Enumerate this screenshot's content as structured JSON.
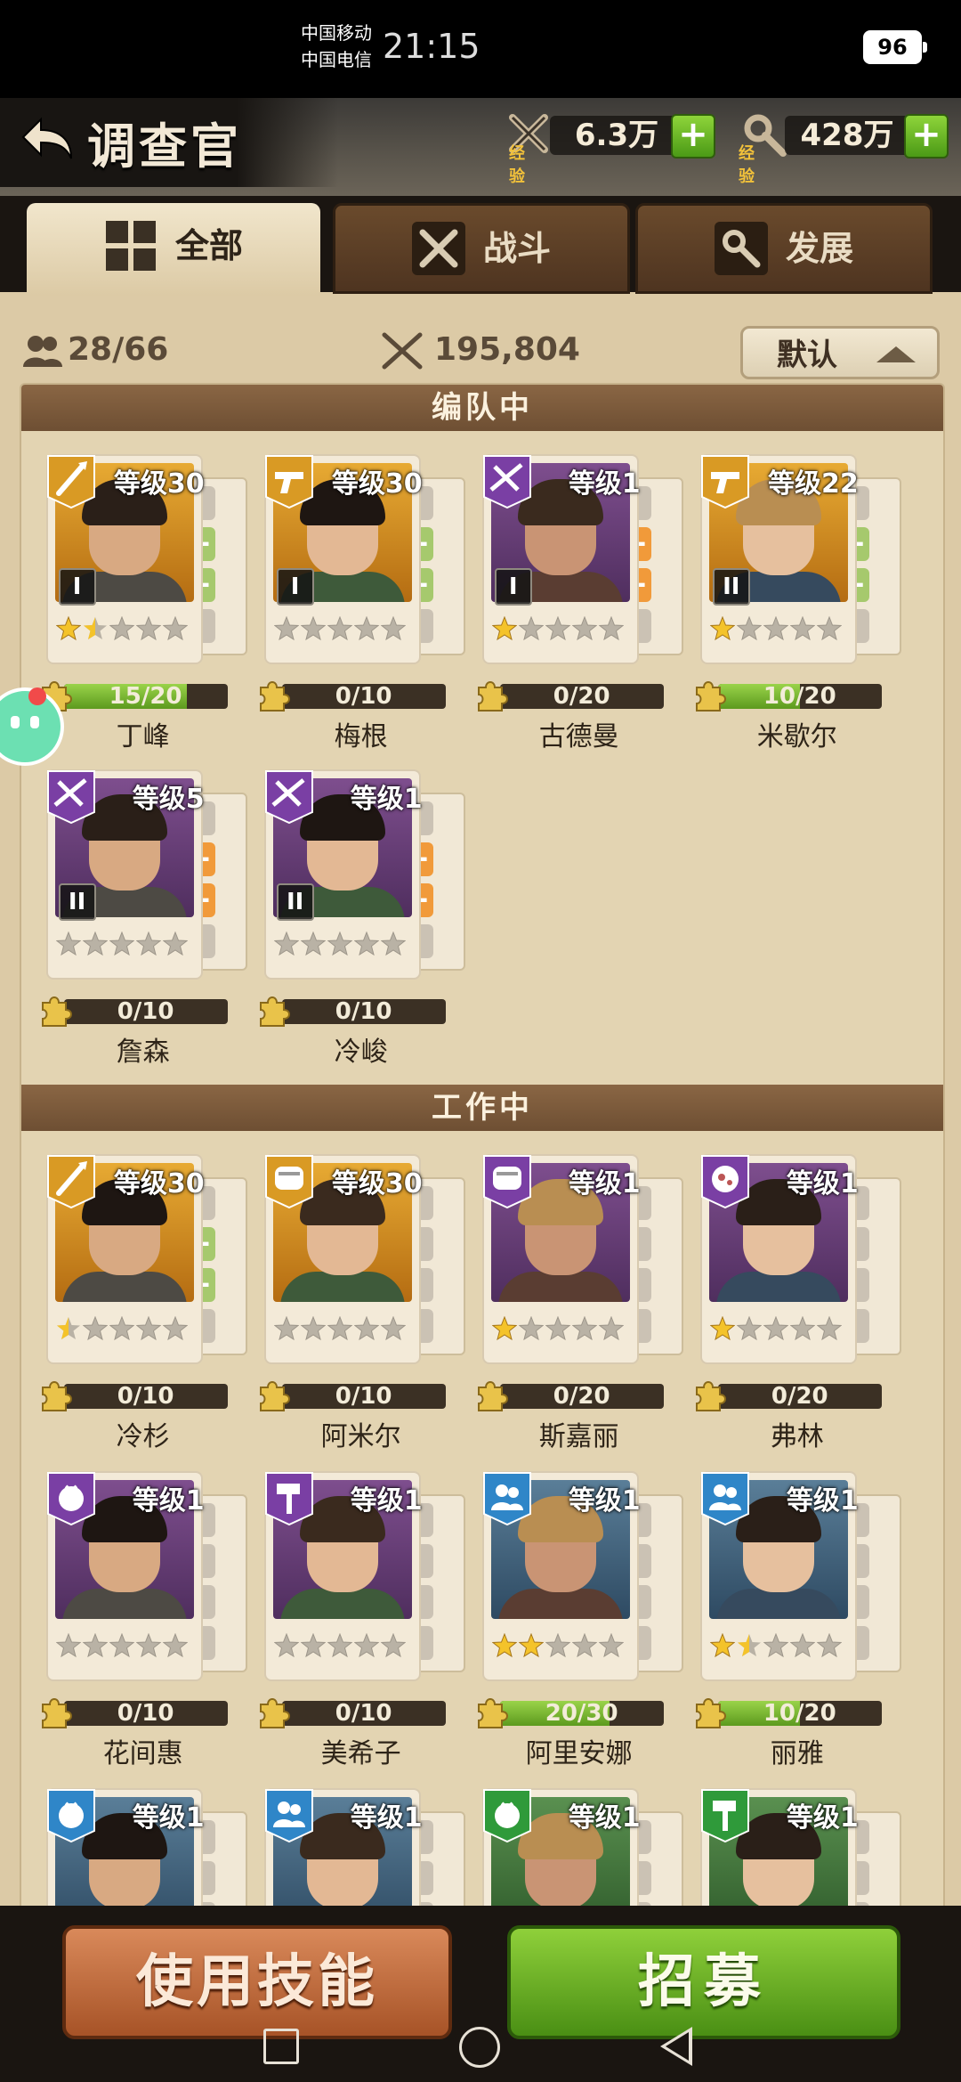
{
  "status_bar": {
    "carrier1": "中国移动",
    "carrier2": "中国电信",
    "time": "21:15",
    "battery": "96"
  },
  "header": {
    "title": "调查官",
    "resources": [
      {
        "icon": "combat-exp-icon",
        "label": "经验",
        "value": "6.3万"
      },
      {
        "icon": "develop-exp-icon",
        "label": "经验",
        "value": "428万"
      }
    ]
  },
  "tabs": [
    {
      "label": "全部",
      "icon": "grid-icon",
      "active": true
    },
    {
      "label": "战斗",
      "icon": "weapons-icon",
      "active": false
    },
    {
      "label": "发展",
      "icon": "tools-icon",
      "active": false
    }
  ],
  "stats": {
    "count": "28/66",
    "power": "195,804",
    "sort_label": "默认"
  },
  "sections": [
    {
      "title": "编队中",
      "cards": [
        {
          "name": "丁峰",
          "level": "等级30",
          "rarity": "gold",
          "role": "melee",
          "tier": "I",
          "stars": 1.5,
          "xp_text": "15/20",
          "xp": 0.75,
          "slots": [
            "empty",
            "plus-g",
            "plus-g",
            "empty"
          ]
        },
        {
          "name": "梅根",
          "level": "等级30",
          "rarity": "gold",
          "role": "pistol",
          "tier": "I",
          "stars": 0,
          "xp_text": "0/10",
          "xp": 0,
          "slots": [
            "empty",
            "plus-g",
            "plus-g",
            "empty"
          ]
        },
        {
          "name": "古德曼",
          "level": "等级1",
          "rarity": "purple",
          "role": "rifle",
          "tier": "I",
          "stars": 1,
          "xp_text": "0/20",
          "xp": 0,
          "slots": [
            "empty",
            "plus-o",
            "plus-o",
            "empty"
          ]
        },
        {
          "name": "米歇尔",
          "level": "等级22",
          "rarity": "gold",
          "role": "pistol",
          "tier": "II",
          "stars": 1,
          "xp_text": "10/20",
          "xp": 0.5,
          "slots": [
            "empty",
            "plus-g",
            "plus-g",
            "empty"
          ]
        },
        {
          "name": "詹森",
          "level": "等级5",
          "rarity": "purple",
          "role": "rifle",
          "tier": "II",
          "stars": 0,
          "xp_text": "0/10",
          "xp": 0,
          "slots": [
            "empty",
            "plus-o",
            "plus-o",
            "empty"
          ]
        },
        {
          "name": "冷峻",
          "level": "等级1",
          "rarity": "purple",
          "role": "rifle",
          "tier": "II",
          "stars": 0,
          "xp_text": "0/10",
          "xp": 0,
          "slots": [
            "empty",
            "plus-o",
            "plus-o",
            "empty"
          ]
        }
      ]
    },
    {
      "title": "工作中",
      "cards": [
        {
          "name": "冷杉",
          "level": "等级30",
          "rarity": "gold",
          "role": "melee",
          "tier": "",
          "stars": 0.5,
          "xp_text": "0/10",
          "xp": 0,
          "slots": [
            "empty",
            "plus-g",
            "plus-g",
            "empty"
          ]
        },
        {
          "name": "阿米尔",
          "level": "等级30",
          "rarity": "gold",
          "role": "scroll",
          "tier": "",
          "stars": 0,
          "xp_text": "0/10",
          "xp": 0,
          "slots": [
            "empty",
            "empty",
            "empty",
            "empty"
          ]
        },
        {
          "name": "斯嘉丽",
          "level": "等级1",
          "rarity": "purple",
          "role": "scroll",
          "tier": "",
          "stars": 1,
          "xp_text": "0/20",
          "xp": 0,
          "slots": [
            "empty",
            "empty",
            "empty",
            "empty"
          ]
        },
        {
          "name": "弗林",
          "level": "等级1",
          "rarity": "purple",
          "role": "meat",
          "tier": "",
          "stars": 1,
          "xp_text": "0/20",
          "xp": 0,
          "slots": [
            "empty",
            "empty",
            "empty",
            "empty"
          ]
        },
        {
          "name": "花间惠",
          "level": "等级1",
          "rarity": "purple",
          "role": "tomato",
          "tier": "",
          "stars": 0,
          "xp_text": "0/10",
          "xp": 0,
          "slots": [
            "empty",
            "empty",
            "empty",
            "empty"
          ]
        },
        {
          "name": "美希子",
          "level": "等级1",
          "rarity": "purple",
          "role": "hammer",
          "tier": "",
          "stars": 0,
          "xp_text": "0/10",
          "xp": 0,
          "slots": [
            "empty",
            "empty",
            "empty",
            "empty"
          ]
        },
        {
          "name": "阿里安娜",
          "level": "等级1",
          "rarity": "blue",
          "role": "people",
          "tier": "",
          "stars": 2,
          "xp_text": "20/30",
          "xp": 0.67,
          "slots": [
            "empty",
            "empty",
            "empty",
            "empty"
          ]
        },
        {
          "name": "丽雅",
          "level": "等级1",
          "rarity": "blue",
          "role": "people",
          "tier": "",
          "stars": 1.5,
          "xp_text": "10/20",
          "xp": 0.5,
          "slots": [
            "empty",
            "empty",
            "empty",
            "empty"
          ]
        },
        {
          "name": "",
          "level": "等级1",
          "rarity": "blue",
          "role": "tomato",
          "tier": "",
          "stars": 0,
          "xp_text": "",
          "xp": 0,
          "slots": [
            "empty",
            "empty",
            "empty",
            "empty"
          ]
        },
        {
          "name": "",
          "level": "等级1",
          "rarity": "blue",
          "role": "people",
          "tier": "",
          "stars": 0,
          "xp_text": "",
          "xp": 0,
          "slots": [
            "empty",
            "empty",
            "empty",
            "empty"
          ]
        },
        {
          "name": "",
          "level": "等级1",
          "rarity": "green",
          "role": "tomato",
          "tier": "",
          "stars": 0,
          "xp_text": "",
          "xp": 0,
          "slots": [
            "empty",
            "empty",
            "empty",
            "empty"
          ]
        },
        {
          "name": "",
          "level": "等级1",
          "rarity": "green",
          "role": "hammer",
          "tier": "",
          "stars": 0,
          "xp_text": "",
          "xp": 0,
          "slots": [
            "empty",
            "empty",
            "empty",
            "empty"
          ]
        }
      ]
    }
  ],
  "buttons": {
    "skill": "使用技能",
    "recruit": "招募"
  },
  "colors": {
    "gold": "#d99a24",
    "purple": "#7a3fa4",
    "blue": "#2f86c8",
    "green": "#2f9a3a",
    "xp_fill": "#7dbb34"
  }
}
